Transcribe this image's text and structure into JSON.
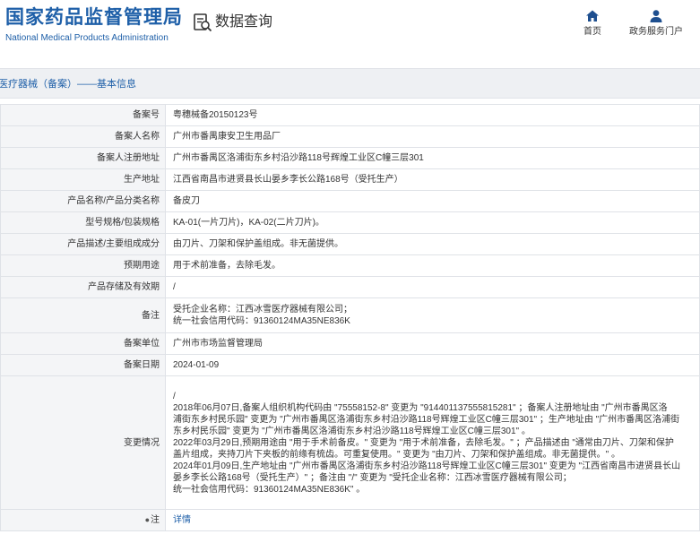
{
  "header": {
    "logo_cn": "国家药品监督管理局",
    "logo_en": "National Medical Products Administration",
    "query_label": "数据查询",
    "nav_home": "首页",
    "nav_portal": "政务服务门户"
  },
  "breadcrumb": "医疗器械（备案）——基本信息",
  "rows": {
    "record_no": {
      "label": "备案号",
      "value": "粤穗械备20150123号"
    },
    "registrant": {
      "label": "备案人名称",
      "value": "广州市番禺康安卫生用品厂"
    },
    "registrant_addr": {
      "label": "备案人注册地址",
      "value": "广州市番禺区洛浦街东乡村沿沙路118号辉煌工业区C幢三层301"
    },
    "production_addr": {
      "label": "生产地址",
      "value": "江西省南昌市进贤县长山晏乡李长公路168号（受托生产）"
    },
    "product_name": {
      "label": "产品名称/产品分类名称",
      "value": "备皮刀"
    },
    "model": {
      "label": "型号规格/包装规格",
      "value": "KA-01(一片刀片)，KA-02(二片刀片)。"
    },
    "description": {
      "label": "产品描述/主要组成成分",
      "value": "由刀片、刀架和保护盖组成。非无菌提供。"
    },
    "usage": {
      "label": "预期用途",
      "value": "用于术前准备，去除毛发。"
    },
    "storage": {
      "label": "产品存储及有效期",
      "value": "/"
    },
    "remark": {
      "label": "备注",
      "line1": "受托企业名称：江西冰雪医疗器械有限公司；",
      "line2": "统一社会信用代码：91360124MA35NE836K"
    },
    "unit": {
      "label": "备案单位",
      "value": "广州市市场监督管理局"
    },
    "date": {
      "label": "备案日期",
      "value": "2024-01-09"
    },
    "changes": {
      "label": "变更情况",
      "lines": [
        "/",
        "2018年06月07日,备案人组织机构代码由 \"75558152-8\" 变更为 \"914401137555815281\" ；备案人注册地址由 \"广州市番禺区洛",
        "浦街东乡村民乐园\" 变更为 \"广州市番禺区洛浦街东乡村沿沙路118号辉煌工业区C幢三层301\" ；生产地址由 \"广州市番禺区洛浦街",
        "东乡村民乐园\" 变更为 \"广州市番禺区洛浦街东乡村沿沙路118号辉煌工业区C幢三层301\" 。",
        "2022年03月29日,预期用途由 \"用于手术前备皮。\" 变更为 \"用于术前准备，去除毛发。\" ；产品描述由 \"通常由刀片、刀架和保护",
        "盖片组成，夹持刀片下夹板的前缘有梳齿。可重复使用。\" 变更为 \"由刀片、刀架和保护盖组成。非无菌提供。\" 。",
        "2024年01月09日,生产地址由 \"广州市番禺区洛浦街东乡村沿沙路118号辉煌工业区C幢三层301\" 变更为 \"江西省南昌市进贤县长山",
        "晏乡李长公路168号（受托生产）\" ；备注由 \"/\" 变更为 \"受托企业名称：江西冰雪医疗器械有限公司；",
        "统一社会信用代码：91360124MA35NE836K\" 。"
      ]
    },
    "note": {
      "label": "注",
      "value": "详情"
    }
  }
}
